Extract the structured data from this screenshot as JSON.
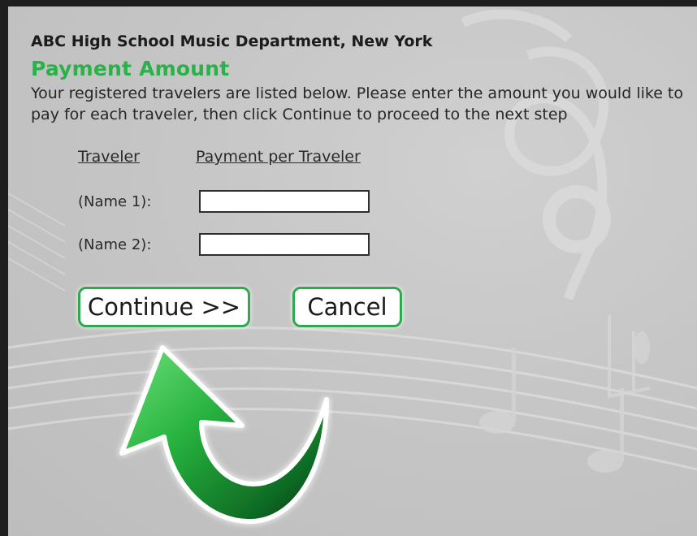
{
  "header": {
    "school": "ABC High School Music Department, New York",
    "title": "Payment Amount",
    "instructions": "Your registered travelers are listed below. Please enter the amount you would like to pay for each traveler, then click Continue to proceed to the next step"
  },
  "table": {
    "columns": [
      "Traveler",
      "Payment per Traveler"
    ],
    "rows": [
      {
        "label": "(Name 1):",
        "value": ""
      },
      {
        "label": "(Name 2):",
        "value": ""
      }
    ]
  },
  "buttons": {
    "continue_label": "Continue >>",
    "cancel_label": "Cancel"
  },
  "colors": {
    "accent_green": "#2bb04a",
    "panel_gray": "#c6c6c6"
  },
  "icons": {
    "arrow": "curved-arrow-icon"
  }
}
